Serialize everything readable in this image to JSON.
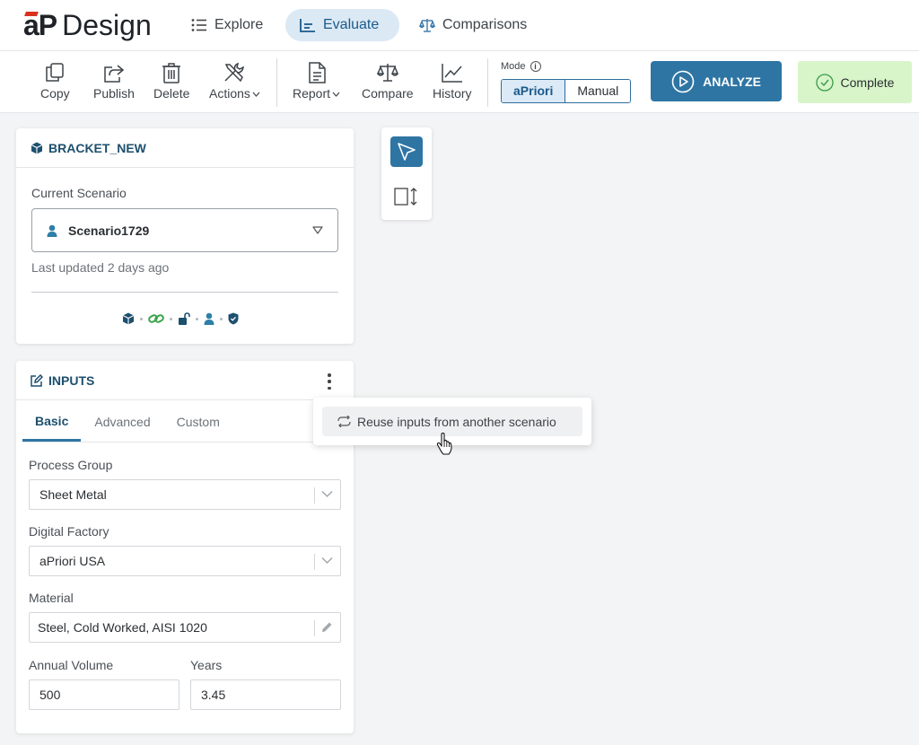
{
  "app": {
    "logo_prefix": "aP",
    "logo_name": "Design"
  },
  "nav": {
    "tabs": [
      {
        "label": "Explore",
        "icon": "list-icon",
        "active": false
      },
      {
        "label": "Evaluate",
        "icon": "chart-icon",
        "active": true
      },
      {
        "label": "Comparisons",
        "icon": "scale-icon",
        "active": false
      }
    ]
  },
  "toolbar": {
    "copy": "Copy",
    "publish": "Publish",
    "delete": "Delete",
    "actions": "Actions",
    "report": "Report",
    "compare": "Compare",
    "history": "History",
    "mode_label": "Mode",
    "mode_options": [
      "aPriori",
      "Manual"
    ],
    "mode_selected": "aPriori",
    "analyze": "ANALYZE",
    "status": "Complete"
  },
  "part_card": {
    "title": "BRACKET_NEW",
    "scenario_label": "Current Scenario",
    "scenario_value": "Scenario1729",
    "updated": "Last updated 2 days ago",
    "status_icons": [
      "cube-icon",
      "link-icon",
      "unlock-icon",
      "user-icon",
      "shield-icon"
    ]
  },
  "inputs_card": {
    "title": "INPUTS",
    "tabs": [
      "Basic",
      "Advanced",
      "Custom"
    ],
    "active_tab": "Basic",
    "process_group_label": "Process Group",
    "process_group_value": "Sheet Metal",
    "digital_factory_label": "Digital Factory",
    "digital_factory_value": "aPriori USA",
    "material_label": "Material",
    "material_value": "Steel, Cold Worked, AISI 1020",
    "annual_volume_label": "Annual Volume",
    "annual_volume_value": "500",
    "years_label": "Years",
    "years_value": "3.45"
  },
  "context_menu": {
    "items": [
      "Reuse inputs from another scenario"
    ]
  },
  "colors": {
    "accent": "#2e75a4",
    "complete_bg": "#d7f5c9",
    "heading": "#1d4f6e"
  }
}
